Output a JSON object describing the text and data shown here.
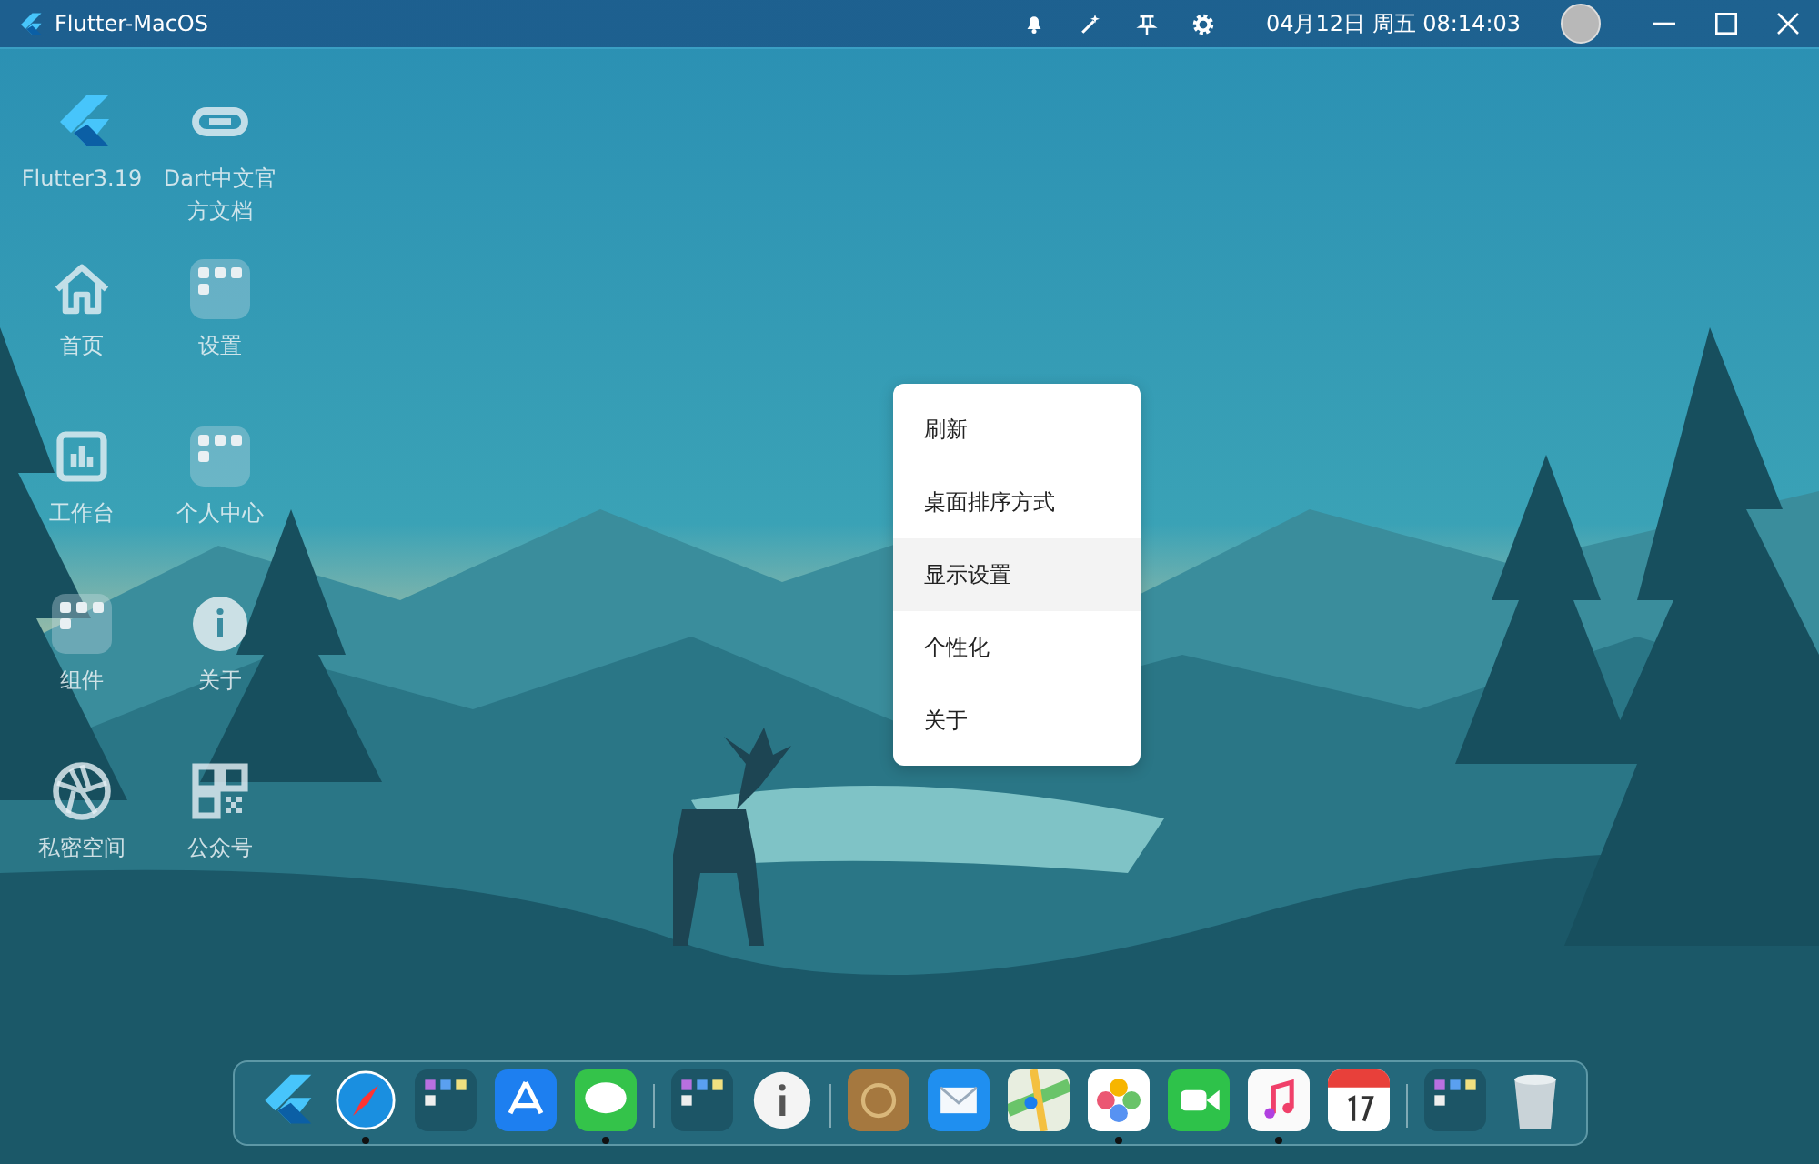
{
  "title_bar": {
    "app_title": "Flutter-MacOS",
    "tray": [
      {
        "kind": "bell"
      },
      {
        "kind": "wand"
      },
      {
        "kind": "pin"
      },
      {
        "kind": "gear"
      }
    ],
    "clock": "04月12日 周五 08:14:03",
    "window_buttons": [
      {
        "kind": "minimize"
      },
      {
        "kind": "maximize"
      },
      {
        "kind": "close"
      }
    ]
  },
  "desktop_icons": [
    {
      "label": "Flutter3.19",
      "kind": "flutter"
    },
    {
      "label": "Dart中文官方文档",
      "kind": "link"
    },
    {
      "label": "首页",
      "kind": "home"
    },
    {
      "label": "设置",
      "kind": "folder"
    },
    {
      "label": "工作台",
      "kind": "chart"
    },
    {
      "label": "个人中心",
      "kind": "folder"
    },
    {
      "label": "组件",
      "kind": "folder"
    },
    {
      "label": "关于",
      "kind": "info"
    },
    {
      "label": "私密空间",
      "kind": "aperture"
    },
    {
      "label": "公众号",
      "kind": "qrcode"
    }
  ],
  "context_menu": {
    "items": [
      {
        "label": "刷新",
        "selected": false
      },
      {
        "label": "桌面排序方式",
        "selected": false
      },
      {
        "label": "显示设置",
        "selected": true
      },
      {
        "label": "个性化",
        "selected": false
      },
      {
        "label": "关于",
        "selected": false
      }
    ]
  },
  "dock": {
    "items": [
      {
        "kind": "flutter",
        "running": false
      },
      {
        "kind": "compass",
        "running": true
      },
      {
        "kind": "folder",
        "running": false
      },
      {
        "kind": "appstore",
        "running": false
      },
      {
        "kind": "messages",
        "running": true
      },
      {
        "kind": "separator"
      },
      {
        "kind": "folder",
        "running": false
      },
      {
        "kind": "info",
        "running": false
      },
      {
        "kind": "separator"
      },
      {
        "kind": "contacts",
        "running": false
      },
      {
        "kind": "mail",
        "running": false
      },
      {
        "kind": "maps",
        "running": false
      },
      {
        "kind": "photos",
        "running": true
      },
      {
        "kind": "facetime",
        "running": false
      },
      {
        "kind": "music",
        "running": true
      },
      {
        "kind": "calendar",
        "running": false
      },
      {
        "kind": "separator"
      },
      {
        "kind": "folder",
        "running": false
      },
      {
        "kind": "trash",
        "running": false
      }
    ]
  }
}
